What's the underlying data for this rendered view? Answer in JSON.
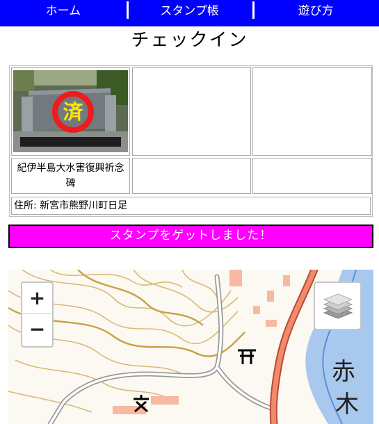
{
  "nav": {
    "items": [
      {
        "label": "ホーム"
      },
      {
        "label": "スタンプ帳"
      },
      {
        "label": "遊び方"
      }
    ],
    "bg_color": "#0000ff"
  },
  "page": {
    "title": "チェックイン"
  },
  "stamps": [
    {
      "name": "紀伊半島大水害復興祈念碑",
      "collected": true,
      "stamp_char": "済"
    },
    {
      "name": "",
      "collected": false
    },
    {
      "name": "",
      "collected": false
    }
  ],
  "address": {
    "text": "住所: 新宮市熊野川町日足"
  },
  "checkin_button": {
    "label": "スタンプをゲットしました！",
    "bg_color": "#ff00ff"
  },
  "map": {
    "zoom_in_label": "+",
    "zoom_out_label": "−",
    "place_label_1": "赤",
    "place_label_2": "木",
    "icons": [
      "plus-icon",
      "minus-icon",
      "layers-icon",
      "school-icon",
      "shrine-icon"
    ]
  }
}
